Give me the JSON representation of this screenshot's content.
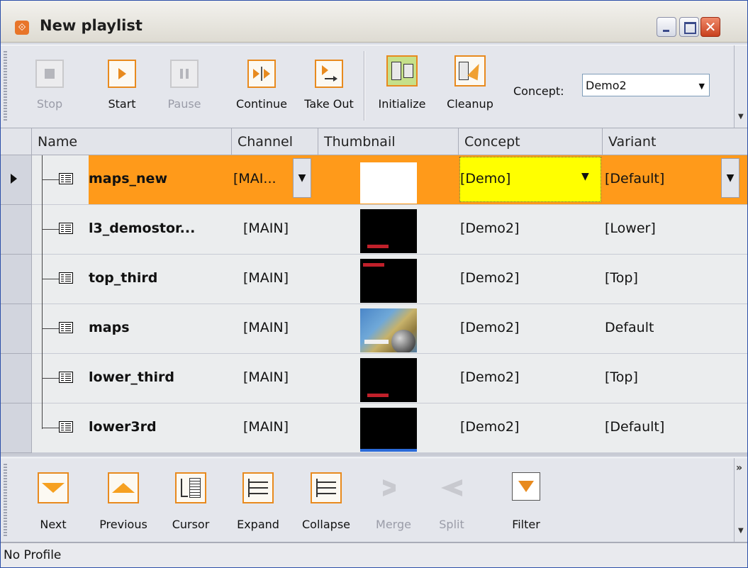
{
  "window": {
    "title": "New playlist",
    "app_icon": "playlist-app-icon"
  },
  "colors": {
    "accent": "#ff9a1a",
    "selected_row": "#ff9a1a",
    "concept_edit": "#ffff00",
    "icon_border": "#e88a1e"
  },
  "top_toolbar": {
    "buttons": [
      {
        "label": "Stop",
        "icon": "stop-icon",
        "enabled": false
      },
      {
        "label": "Start",
        "icon": "play-icon",
        "enabled": true
      },
      {
        "label": "Pause",
        "icon": "pause-icon",
        "enabled": false
      },
      {
        "label": "Continue",
        "icon": "continue-icon",
        "enabled": true
      },
      {
        "label": "Take Out",
        "icon": "take-out-icon",
        "enabled": true
      },
      {
        "label": "Initialize",
        "icon": "initialize-icon",
        "enabled": true
      },
      {
        "label": "Cleanup",
        "icon": "cleanup-icon",
        "enabled": true
      }
    ],
    "concept_label": "Concept:",
    "concept_value": "Demo2"
  },
  "grid": {
    "columns": [
      "Name",
      "Channel",
      "Thumbnail",
      "Concept",
      "Variant"
    ],
    "rows": [
      {
        "name": "maps_new",
        "channel": "[MAI...",
        "concept": "[Demo]",
        "variant": "[Default]",
        "thumb": "white",
        "selected": true
      },
      {
        "name": "l3_demostor...",
        "channel": "[MAIN]",
        "concept": "[Demo2]",
        "variant": "[Lower]",
        "thumb": "lower"
      },
      {
        "name": "top_third",
        "channel": "[MAIN]",
        "concept": "[Demo2]",
        "variant": "[Top]",
        "thumb": "top"
      },
      {
        "name": "maps",
        "channel": "[MAIN]",
        "concept": "[Demo2]",
        "variant": "Default",
        "thumb": "map"
      },
      {
        "name": "lower_third",
        "channel": "[MAIN]",
        "concept": "[Demo2]",
        "variant": "[Top]",
        "thumb": "lower"
      },
      {
        "name": "lower3rd",
        "channel": "[MAIN]",
        "concept": "[Demo2]",
        "variant": "[Default]",
        "thumb": "bluebar"
      }
    ]
  },
  "bottom_toolbar": {
    "buttons": [
      {
        "label": "Next",
        "icon": "arrow-down-icon",
        "enabled": true
      },
      {
        "label": "Previous",
        "icon": "arrow-up-icon",
        "enabled": true
      },
      {
        "label": "Cursor",
        "icon": "cursor-icon",
        "enabled": true
      },
      {
        "label": "Expand",
        "icon": "expand-icon",
        "enabled": true
      },
      {
        "label": "Collapse",
        "icon": "collapse-icon",
        "enabled": true
      },
      {
        "label": "Merge",
        "icon": "merge-icon",
        "enabled": false
      },
      {
        "label": "Split",
        "icon": "split-icon",
        "enabled": false
      },
      {
        "label": "Filter",
        "icon": "filter-icon",
        "enabled": true
      }
    ]
  },
  "status_bar": {
    "text": "No Profile"
  }
}
